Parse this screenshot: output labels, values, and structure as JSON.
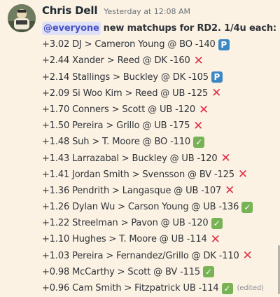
{
  "message": {
    "author": "Chris Dell",
    "timestamp": "Yesterday at 12:08 AM",
    "mention": "@everyone",
    "intro": "new matchups for RD2. 1/4u each:",
    "edited_label": "(edited)",
    "picks": [
      {
        "text": "+3.02 DJ > Cameron Young @ BO -140",
        "status": "pending-icon"
      },
      {
        "text": "+2.44 Xander > Reed @ DK -160",
        "status": "cross-icon"
      },
      {
        "text": "+2.14 Stallings > Buckley @ DK -105",
        "status": "pending-icon"
      },
      {
        "text": "+2.09 Si Woo Kim > Reed @ UB -125",
        "status": "cross-icon"
      },
      {
        "text": "+1.70 Conners > Scott @ UB -120",
        "status": "cross-icon"
      },
      {
        "text": "+1.50 Pereira > Grillo @ UB -175",
        "status": "cross-icon"
      },
      {
        "text": "+1.48 Suh > T. Moore @ BO -110",
        "status": "check-icon"
      },
      {
        "text": "+1.43 Larrazabal > Buckley @ UB -120",
        "status": "cross-icon"
      },
      {
        "text": "+1.41 Jordan Smith > Svensson @ BV -125",
        "status": "cross-icon"
      },
      {
        "text": "+1.36 Pendrith > Langasque @ UB -107",
        "status": "cross-icon"
      },
      {
        "text": "+1.26 Dylan Wu > Carson Young @ UB -136",
        "status": "check-icon"
      },
      {
        "text": "+1.22 Streelman > Pavon @ UB -120",
        "status": "check-icon"
      },
      {
        "text": "+1.10 Hughes > T. Moore @ UB -114",
        "status": "cross-icon"
      },
      {
        "text": "+1.03 Pereira > Fernandez/Grillo @ DK -110",
        "status": "cross-icon"
      },
      {
        "text": "+0.98 McCarthy > Scott @ BV -115",
        "status": "check-icon"
      },
      {
        "text": "+0.96 Cam Smith > Fitzpatrick UB -114",
        "status": "check-icon"
      }
    ]
  },
  "icons": {
    "cross-icon": {
      "glyph": "✕"
    },
    "check-icon": {
      "glyph": "✓"
    },
    "pending-icon": {
      "glyph": "P"
    }
  },
  "colors": {
    "background": "#fcf2e4",
    "mention_bg": "#dfe1f7",
    "mention_text": "#4752c4",
    "cross": "#dd2e44",
    "check": "#77b255",
    "pending": "#3b88c3"
  }
}
